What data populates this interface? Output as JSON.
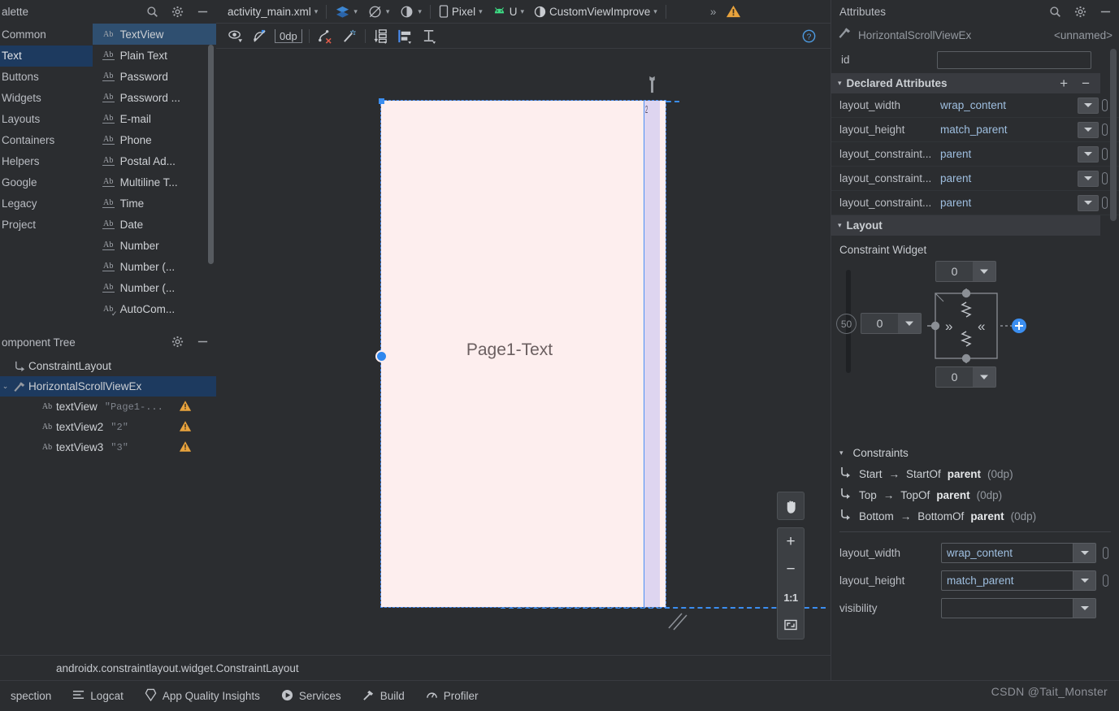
{
  "palette": {
    "title": "alette",
    "icons": [
      "search-icon",
      "gear-icon",
      "minimize-icon"
    ],
    "groups": [
      {
        "label": "Common",
        "selected": false
      },
      {
        "label": "Text",
        "selected": true
      },
      {
        "label": "Buttons",
        "selected": false
      },
      {
        "label": "Widgets",
        "selected": false
      },
      {
        "label": "Layouts",
        "selected": false
      },
      {
        "label": "Containers",
        "selected": false
      },
      {
        "label": "Helpers",
        "selected": false
      },
      {
        "label": "Google",
        "selected": false
      },
      {
        "label": "Legacy",
        "selected": false
      },
      {
        "label": "Project",
        "selected": false
      }
    ],
    "items": [
      {
        "label": "TextView",
        "icon": "Ab",
        "style": "plain",
        "selected": true
      },
      {
        "label": "Plain Text",
        "icon": "Ab",
        "style": "underline",
        "selected": false
      },
      {
        "label": "Password",
        "icon": "Ab",
        "style": "underline",
        "selected": false
      },
      {
        "label": "Password ...",
        "icon": "Ab",
        "style": "underline",
        "selected": false
      },
      {
        "label": "E-mail",
        "icon": "Ab",
        "style": "underline",
        "selected": false
      },
      {
        "label": "Phone",
        "icon": "Ab",
        "style": "underline",
        "selected": false
      },
      {
        "label": "Postal Ad...",
        "icon": "Ab",
        "style": "underline",
        "selected": false
      },
      {
        "label": "Multiline T...",
        "icon": "Ab",
        "style": "underline",
        "selected": false
      },
      {
        "label": "Time",
        "icon": "Ab",
        "style": "underline",
        "selected": false
      },
      {
        "label": "Date",
        "icon": "Ab",
        "style": "underline",
        "selected": false
      },
      {
        "label": "Number",
        "icon": "Ab",
        "style": "underline",
        "selected": false
      },
      {
        "label": "Number (...",
        "icon": "Ab",
        "style": "underline",
        "selected": false
      },
      {
        "label": "Number (...",
        "icon": "Ab",
        "style": "underline",
        "selected": false
      },
      {
        "label": "AutoCom...",
        "icon": "Ab",
        "style": "check",
        "selected": false
      }
    ]
  },
  "component_tree": {
    "title": "omponent Tree",
    "icons": [
      "gear-icon",
      "minimize-icon"
    ],
    "rows": [
      {
        "label": "ConstraintLayout",
        "value": "",
        "icon": "constraint-icon",
        "indent": 0,
        "arrow": "",
        "selected": false,
        "warning": false
      },
      {
        "label": "HorizontalScrollViewEx",
        "value": "",
        "icon": "custom-view-icon",
        "indent": 0,
        "arrow": "⌄",
        "selected": true,
        "warning": false
      },
      {
        "label": "textView",
        "value": "\"Page1-...",
        "icon": "Ab",
        "indent": 1,
        "arrow": "",
        "selected": false,
        "warning": true
      },
      {
        "label": "textView2",
        "value": "\"2\"",
        "icon": "Ab",
        "indent": 1,
        "arrow": "",
        "selected": false,
        "warning": true
      },
      {
        "label": "textView3",
        "value": "\"3\"",
        "icon": "Ab",
        "indent": 1,
        "arrow": "",
        "selected": false,
        "warning": true
      }
    ]
  },
  "editor": {
    "file_tab": "activity_main.xml",
    "toolbar_top": {
      "design_mode_icon": "layers-icon",
      "blueprint_icon": "blueprint-icon",
      "theme_icon": "theme-icon",
      "device": "Pixel",
      "api": "U",
      "module": "CustomViewImprove",
      "overflow": "»",
      "warning_icon": "warning-icon"
    },
    "toolbar_design": {
      "visibility_icon": "eye-icon",
      "constraints_icon": "constraints-off-icon",
      "margin_value": "0dp",
      "clear_constraints_icon": "clear-constraints-icon",
      "infer_icon": "magic-wand-icon",
      "guideline_icon": "guideline-icon",
      "align_icon": "align-icon",
      "pack_icon": "pack-icon",
      "help_icon": "help-icon"
    },
    "canvas": {
      "preview_text": "Page1-Text",
      "strip_label": "2",
      "wrench_icon": "wrench-icon"
    },
    "zoom_controls": {
      "pan": "pan-hand-icon",
      "zoom_in": "+",
      "zoom_out": "−",
      "actual_size": "1:1",
      "zoom_to_fit": "fit-screen-icon"
    },
    "class_label": "androidx.constraintlayout.widget.ConstraintLayout"
  },
  "attributes": {
    "title": "Attributes",
    "icons": [
      "search-icon",
      "gear-icon",
      "minimize-icon"
    ],
    "component_name": "HorizontalScrollViewEx",
    "component_id": "<unnamed>",
    "id_label": "id",
    "id_value": "",
    "declared": {
      "title": "Declared Attributes",
      "add_label": "+",
      "remove_label": "−",
      "rows": [
        {
          "name": "layout_width",
          "value": "wrap_content"
        },
        {
          "name": "layout_height",
          "value": "match_parent"
        },
        {
          "name": "layout_constraint...",
          "value": "parent"
        },
        {
          "name": "layout_constraint...",
          "value": "parent"
        },
        {
          "name": "layout_constraint...",
          "value": "parent"
        }
      ]
    },
    "layout": {
      "title": "Layout",
      "widget_title": "Constraint Widget",
      "margin_top": "0",
      "margin_left": "0",
      "margin_bottom": "0",
      "bias_value": "50",
      "expand_horizontal": "»",
      "collapse_horizontal": "«"
    },
    "constraints": {
      "title": "Constraints",
      "rows": [
        {
          "from": "Start",
          "arrow": "→",
          "to": "StartOf",
          "target": "parent",
          "value": "(0dp)"
        },
        {
          "from": "Top",
          "arrow": "→",
          "to": "TopOf",
          "target": "parent",
          "value": "(0dp)"
        },
        {
          "from": "Bottom",
          "arrow": "→",
          "to": "BottomOf",
          "target": "parent",
          "value": "(0dp)"
        }
      ]
    },
    "bottom_rows": [
      {
        "name": "layout_width",
        "value": "wrap_content"
      },
      {
        "name": "layout_height",
        "value": "match_parent"
      },
      {
        "name": "visibility",
        "value": ""
      }
    ]
  },
  "bottom_bar": {
    "items": [
      {
        "label": "spection",
        "icon": ""
      },
      {
        "label": "Logcat",
        "icon": "logcat-icon"
      },
      {
        "label": "App Quality Insights",
        "icon": "diamond-icon"
      },
      {
        "label": "Services",
        "icon": "play-circle-icon"
      },
      {
        "label": "Build",
        "icon": "hammer-icon"
      },
      {
        "label": "Profiler",
        "icon": "profiler-icon"
      }
    ],
    "watermark": "CSDN @Tait_Monster"
  },
  "colors": {
    "accent_blue": "#3b8ef0",
    "selection_bg": "#1d3a5f",
    "panel_bg": "#2b2d30",
    "device_bg": "#fdeeee",
    "strip_purple": "#ded5f0",
    "warning_orange": "#e8a33d"
  }
}
